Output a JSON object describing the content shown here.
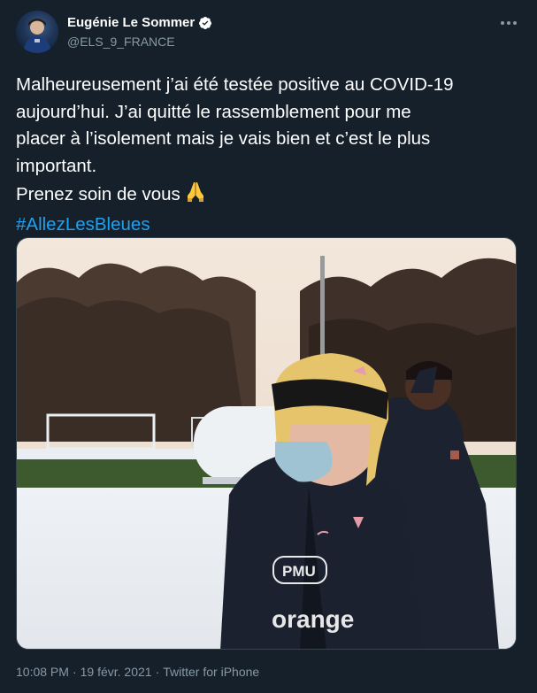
{
  "tweet": {
    "author": {
      "display_name": "Eugénie Le Sommer",
      "handle": "@ELS_9_FRANCE",
      "verified": true
    },
    "text_lines": [
      "Malheureusement j’ai été testée positive au COVID-19",
      "aujourd’hui. J’ai quitté le rassemblement pour me",
      "placer à l’isolement mais je vais bien et c’est le plus",
      "important.",
      "Prenez soin de vous"
    ],
    "emoji": "folded-hands-emoji",
    "hashtag": "#AllezLesBleues",
    "media": {
      "type": "photo",
      "shirt_sponsor": "PMU",
      "shirt_brand": "orange"
    },
    "meta": {
      "time": "10:08 PM",
      "separator": "·",
      "date": "19 févr. 2021",
      "separator2": "·",
      "source": "Twitter for iPhone"
    }
  },
  "colors": {
    "background": "#15202b",
    "text": "#ffffff",
    "secondary": "#8899a6",
    "link": "#1da1f2",
    "border": "#38444d"
  }
}
